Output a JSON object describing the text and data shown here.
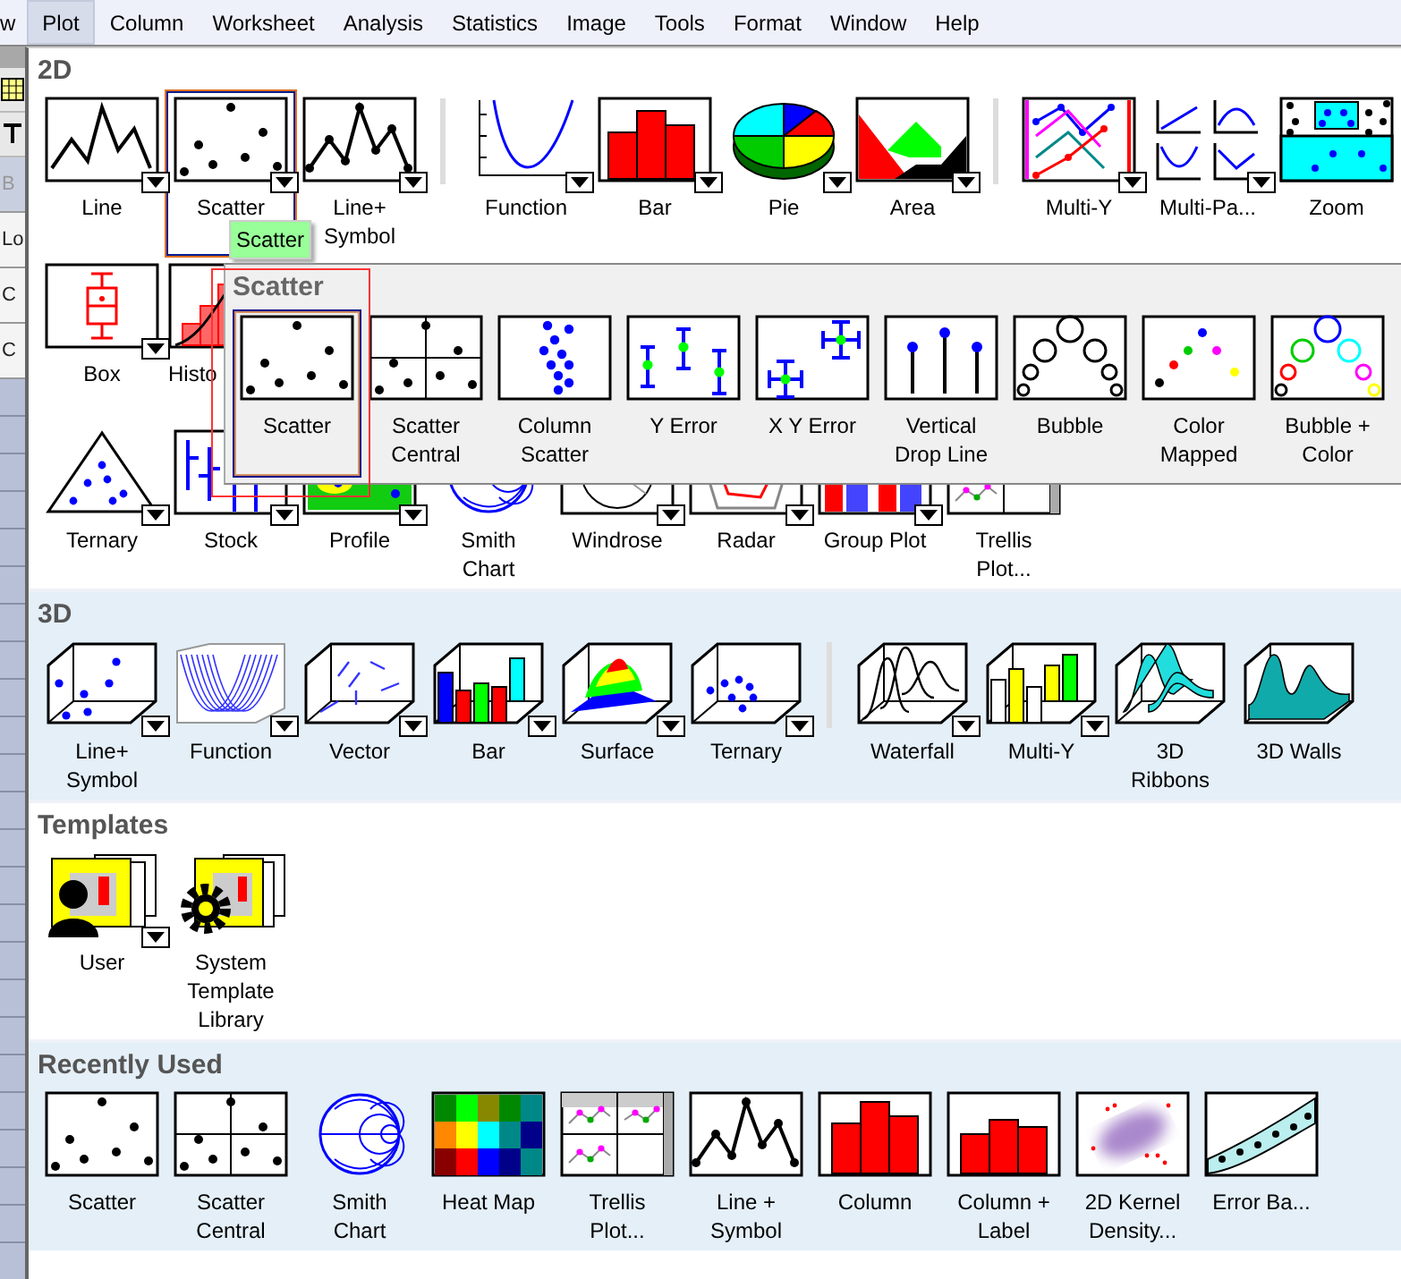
{
  "menu_bar": [
    {
      "label": "w",
      "selected": false
    },
    {
      "label": "Plot",
      "selected": true
    },
    {
      "label": "Column",
      "selected": false
    },
    {
      "label": "Worksheet",
      "selected": false
    },
    {
      "label": "Analysis",
      "selected": false
    },
    {
      "label": "Statistics",
      "selected": false
    },
    {
      "label": "Image",
      "selected": false
    },
    {
      "label": "Tools",
      "selected": false
    },
    {
      "label": "Format",
      "selected": false
    },
    {
      "label": "Window",
      "selected": false
    },
    {
      "label": "Help",
      "selected": false
    }
  ],
  "side_panel": {
    "labels": [
      "B",
      "Lo",
      "C",
      "C"
    ]
  },
  "sections": [
    {
      "title": "2D",
      "rows": [
        [
          {
            "label": "Line",
            "selected": false,
            "dropdown": true
          },
          {
            "label": "Scatter",
            "selected": true,
            "dropdown": true
          },
          {
            "label": "Line+ Symbol",
            "selected": false,
            "dropdown": true
          },
          {
            "label": "Function",
            "selected": false,
            "dropdown": true
          },
          {
            "label": "Bar",
            "selected": false,
            "dropdown": true
          },
          {
            "label": "Pie",
            "selected": false,
            "dropdown": true
          },
          {
            "label": "Area",
            "selected": false,
            "dropdown": true
          },
          {
            "label": "Multi-Y",
            "selected": false,
            "dropdown": true
          },
          {
            "label": "Multi-Pa...",
            "selected": false,
            "dropdown": true
          },
          {
            "label": "Zoom",
            "selected": false,
            "dropdown": false
          }
        ],
        [
          {
            "label": "Box",
            "selected": false,
            "dropdown": true
          },
          {
            "label": "Histo",
            "selected": false,
            "dropdown": false
          }
        ],
        [
          {
            "label": "Ternary",
            "selected": false,
            "dropdown": true
          },
          {
            "label": "Stock",
            "selected": false,
            "dropdown": true
          },
          {
            "label": "Profile",
            "selected": false,
            "dropdown": true
          },
          {
            "label": "Smith Chart",
            "selected": false,
            "dropdown": false
          },
          {
            "label": "Windrose",
            "selected": false,
            "dropdown": true
          },
          {
            "label": "Radar",
            "selected": false,
            "dropdown": true
          },
          {
            "label": "Group Plot",
            "selected": false,
            "dropdown": true
          },
          {
            "label": "Trellis Plot...",
            "selected": false,
            "dropdown": false
          }
        ]
      ]
    },
    {
      "title": "3D",
      "rows": [
        [
          {
            "label": "Line+ Symbol",
            "selected": false,
            "dropdown": true
          },
          {
            "label": "Function",
            "selected": false,
            "dropdown": true
          },
          {
            "label": "Vector",
            "selected": false,
            "dropdown": true
          },
          {
            "label": "Bar",
            "selected": false,
            "dropdown": true
          },
          {
            "label": "Surface",
            "selected": false,
            "dropdown": true
          },
          {
            "label": "Ternary",
            "selected": false,
            "dropdown": true
          },
          {
            "label": "Waterfall",
            "selected": false,
            "dropdown": true
          },
          {
            "label": "Multi-Y",
            "selected": false,
            "dropdown": true
          },
          {
            "label": "3D Ribbons",
            "selected": false,
            "dropdown": false
          },
          {
            "label": "3D Walls",
            "selected": false,
            "dropdown": false
          }
        ]
      ]
    },
    {
      "title": "Templates",
      "rows": [
        [
          {
            "label": "User",
            "selected": false,
            "dropdown": true
          },
          {
            "label": "System Template Library",
            "selected": false,
            "dropdown": false
          }
        ]
      ]
    },
    {
      "title": "Recently Used",
      "rows": [
        [
          {
            "label": "Scatter",
            "selected": false,
            "dropdown": false
          },
          {
            "label": "Scatter Central",
            "selected": false,
            "dropdown": false
          },
          {
            "label": "Smith Chart",
            "selected": false,
            "dropdown": false
          },
          {
            "label": "Heat Map",
            "selected": false,
            "dropdown": false
          },
          {
            "label": "Trellis Plot...",
            "selected": false,
            "dropdown": false
          },
          {
            "label": "Line + Symbol",
            "selected": false,
            "dropdown": false
          },
          {
            "label": "Column",
            "selected": false,
            "dropdown": false
          },
          {
            "label": "Column + Label",
            "selected": false,
            "dropdown": false
          },
          {
            "label": "2D Kernel Density...",
            "selected": false,
            "dropdown": false
          },
          {
            "label": "Error Ba...",
            "selected": false,
            "dropdown": false
          }
        ]
      ]
    }
  ],
  "tooltip": "Scatter",
  "submenu": {
    "title": "Scatter",
    "items": [
      {
        "label": "Scatter",
        "selected": true
      },
      {
        "label": "Scatter Central",
        "selected": false
      },
      {
        "label": "Column Scatter",
        "selected": false
      },
      {
        "label": "Y Error",
        "selected": false
      },
      {
        "label": "X Y Error",
        "selected": false
      },
      {
        "label": "Vertical Drop Line",
        "selected": false
      },
      {
        "label": "Bubble",
        "selected": false
      },
      {
        "label": "Color Mapped",
        "selected": false
      },
      {
        "label": "Bubble + Color",
        "selected": false
      }
    ]
  }
}
